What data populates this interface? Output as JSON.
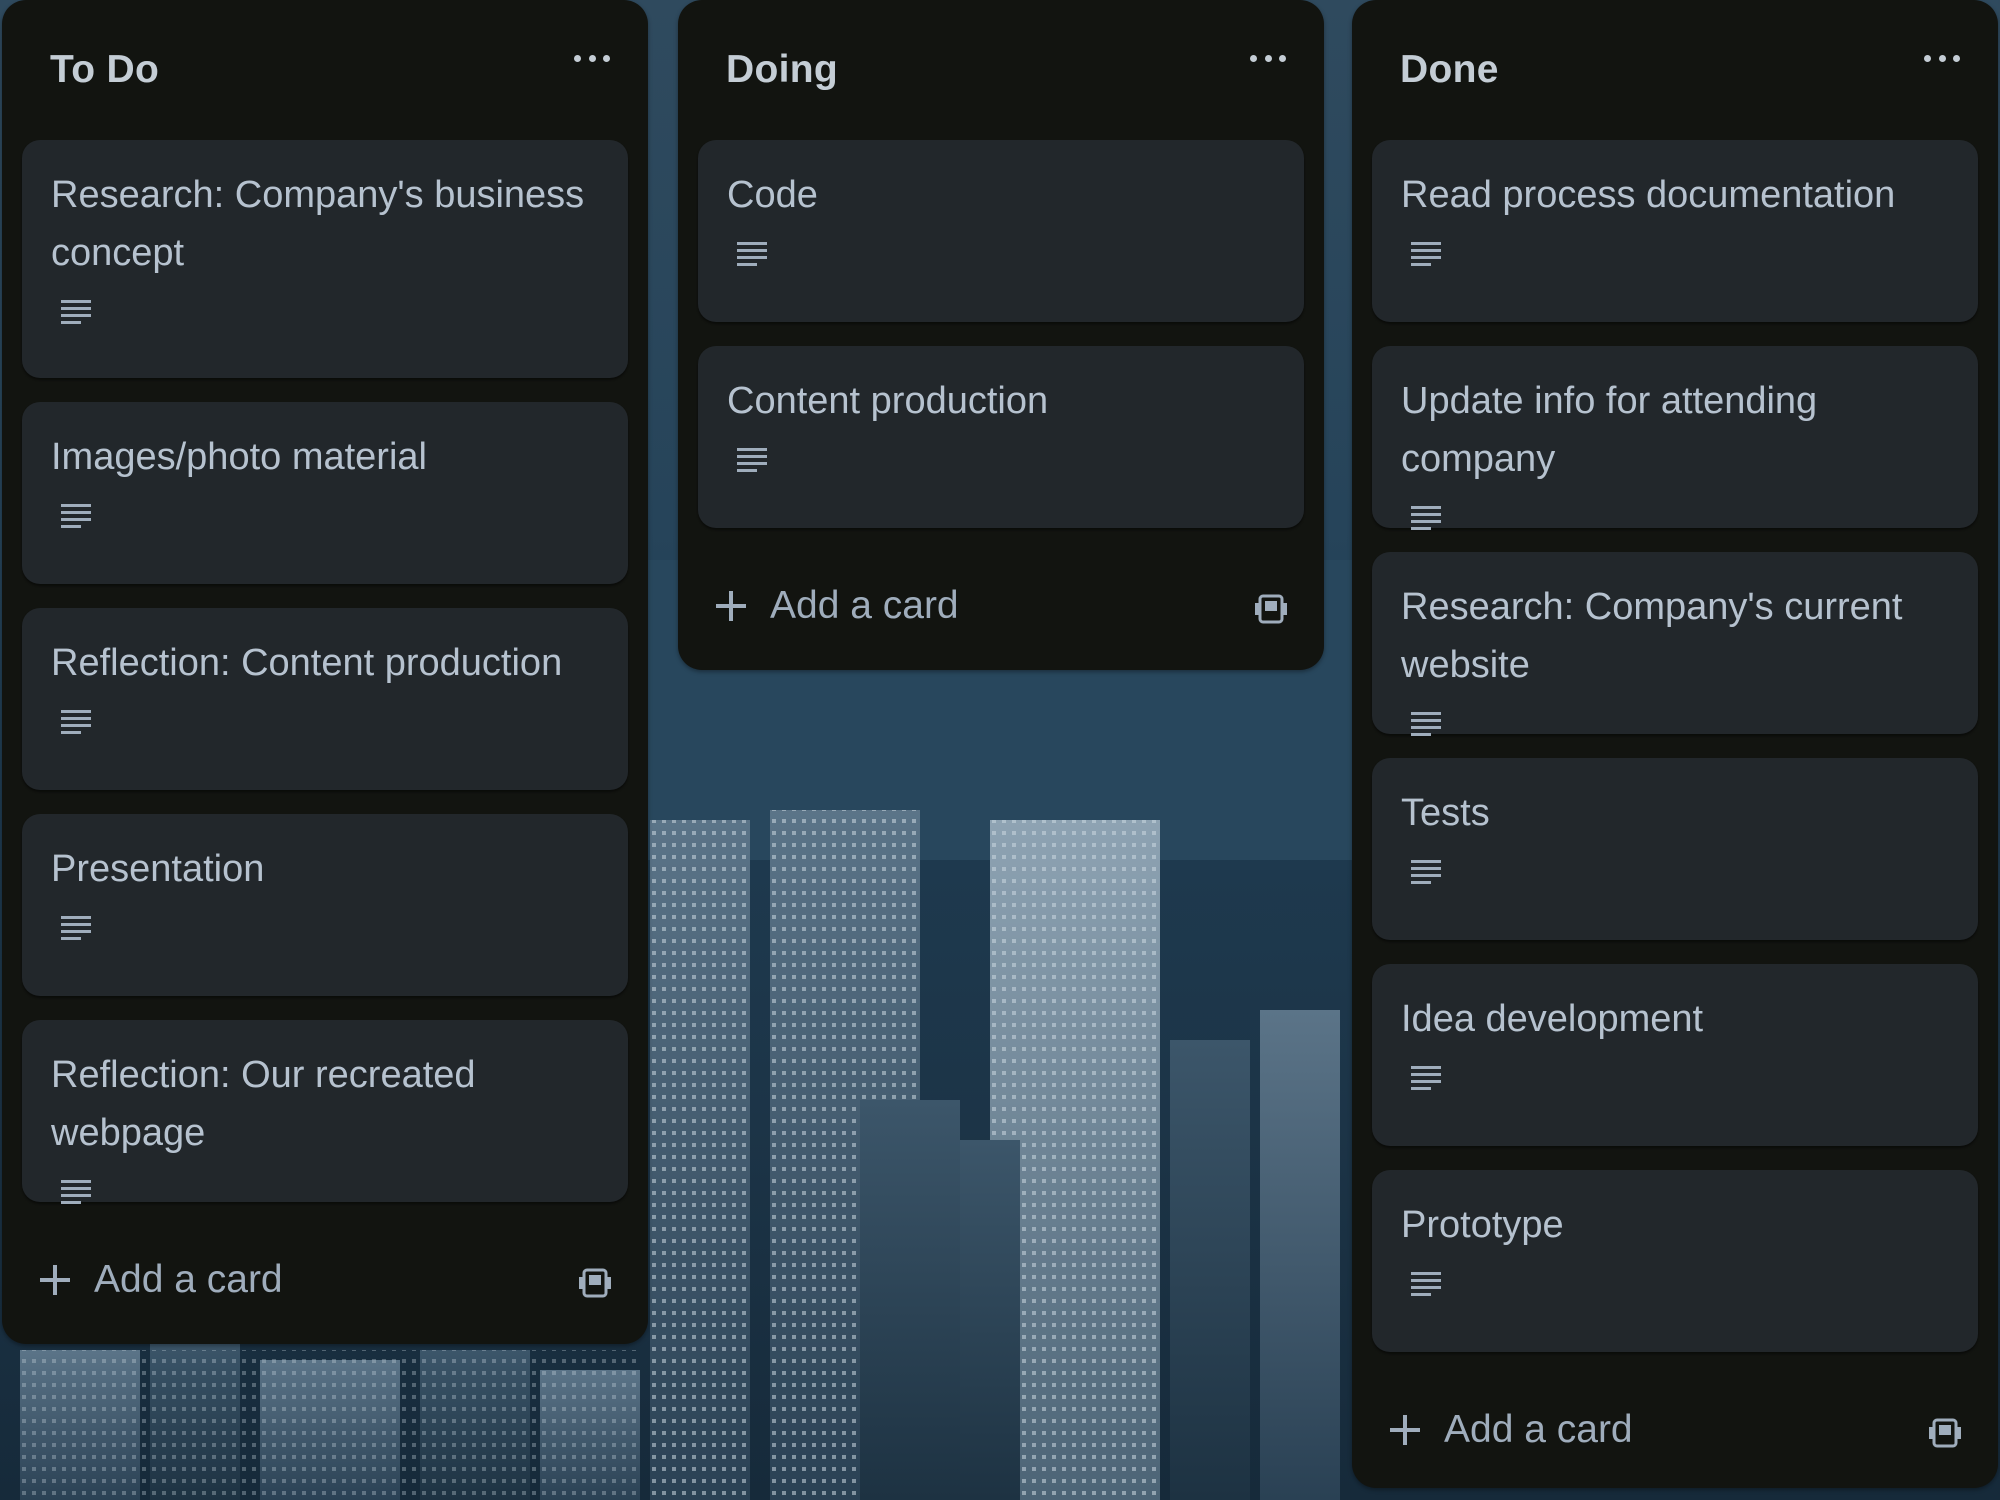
{
  "board": {
    "lists": [
      {
        "title": "To Do",
        "cards": [
          "Research: Company's business concept",
          "Images/photo material",
          "Reflection: Content production",
          "Presentation",
          "Reflection: Our recreated webpage"
        ],
        "add_label": "Add a card"
      },
      {
        "title": "Doing",
        "cards": [
          "Code",
          "Content production"
        ],
        "add_label": "Add a card"
      },
      {
        "title": "Done",
        "cards": [
          "Read process documentation",
          "Update info for attending company",
          "Research: Company's current website",
          "Tests",
          "Idea development",
          "Prototype"
        ],
        "add_label": "Add a card"
      }
    ]
  },
  "icons": {
    "list_menu": "more-horizontal-icon",
    "card_description": "description-icon",
    "add": "plus-icon",
    "template": "card-template-icon"
  },
  "colors": {
    "list_background": "#121410",
    "card_background": "#22272b",
    "text": "#b6c2cf"
  }
}
